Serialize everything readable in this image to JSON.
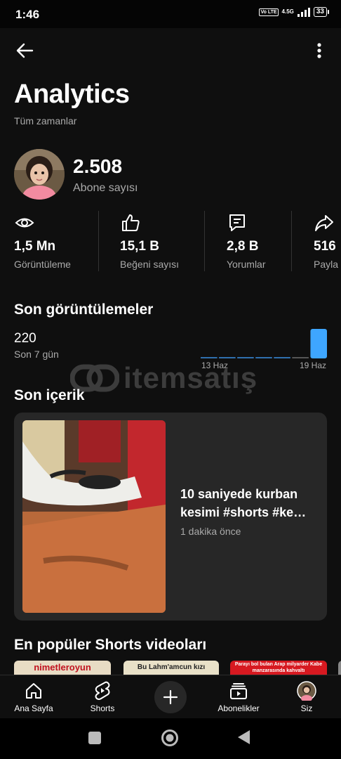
{
  "status_bar": {
    "time": "1:46",
    "volte": "Vo LTE",
    "network": "4.5G",
    "battery": "33"
  },
  "header": {
    "title": "Analytics",
    "subtitle": "Tüm zamanlar"
  },
  "channel": {
    "subscriber_count": "2.508",
    "subscriber_label": "Abone sayısı"
  },
  "stats": [
    {
      "icon": "eye-icon",
      "value": "1,5 Mn",
      "label": "Görüntüleme"
    },
    {
      "icon": "thumbs-up-icon",
      "value": "15,1 B",
      "label": "Beğeni sayısı"
    },
    {
      "icon": "comment-icon",
      "value": "2,8 B",
      "label": "Yorumlar"
    },
    {
      "icon": "share-icon",
      "value": "516",
      "label": "Payla"
    }
  ],
  "recent_views": {
    "title": "Son görüntülemeler",
    "value": "220",
    "period": "Son 7 gün",
    "start_label": "13 Haz",
    "end_label": "19 Haz"
  },
  "chart_data": {
    "type": "bar",
    "categories": [
      "13 Haz",
      "",
      "",
      "",
      "",
      "",
      "19 Haz"
    ],
    "values": [
      2,
      2,
      2,
      2,
      2,
      1,
      210
    ],
    "title": "",
    "xlabel": "",
    "ylabel": ""
  },
  "watermark": {
    "text": "itemsatış"
  },
  "recent_content": {
    "title": "Son içerik",
    "video_title": "10 saniyede kurban kesimi #shorts #ke…",
    "video_time": "1 dakika önce"
  },
  "popular_shorts": {
    "title": "En popüler Shorts videoları",
    "items": [
      {
        "text": "nimetleroyun"
      },
      {
        "text": "Bu Lahm'amcun kızı"
      },
      {
        "text": "Parayı bol bulan Arap milyarder Kabe manzarasında kahvaltı"
      }
    ]
  },
  "bottom_nav": {
    "home": "Ana Sayfa",
    "shorts": "Shorts",
    "subscriptions": "Abonelikler",
    "you": "Siz"
  },
  "colors": {
    "background": "#0f0f0f",
    "card": "#272727",
    "accent_bar": "#3ea6ff",
    "muted_text": "#aaaaaa"
  }
}
